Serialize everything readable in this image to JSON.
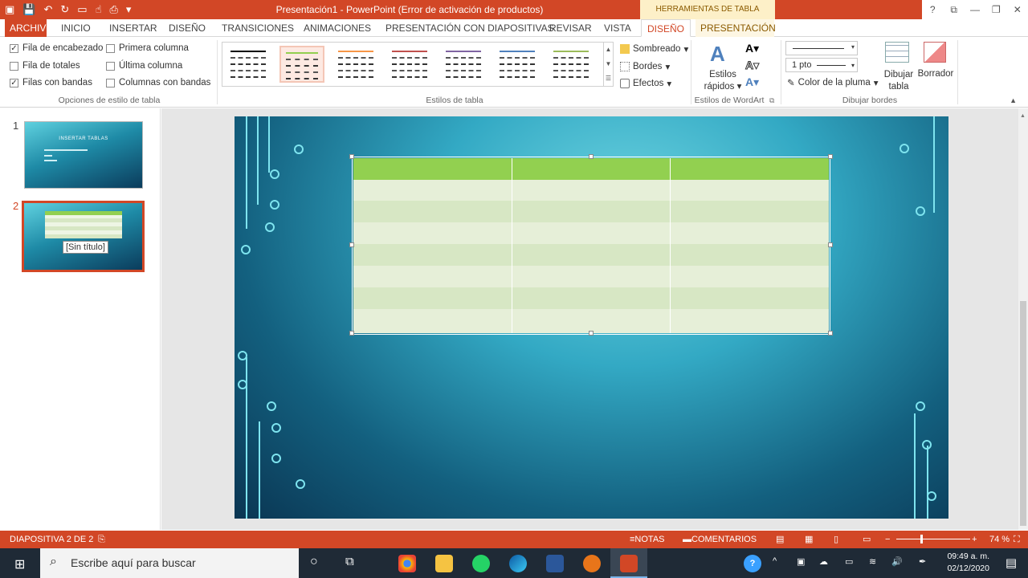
{
  "titlebar": {
    "app_title": "Presentación1 - PowerPoint (Error de activación de productos)",
    "contextual_header": "HERRAMIENTAS DE TABLA",
    "help": "?"
  },
  "tabs": {
    "file": "ARCHIVO",
    "inicio": "INICIO",
    "insertar": "INSERTAR",
    "diseno": "DISEÑO",
    "transiciones": "TRANSICIONES",
    "animaciones": "ANIMACIONES",
    "presentacion": "PRESENTACIÓN CON DIAPOSITIVAS",
    "revisar": "REVISAR",
    "vista": "VISTA",
    "diseno_tabla": "DISEÑO",
    "presentacion_tabla": "PRESENTACIÓN"
  },
  "ribbon": {
    "options": {
      "fila_encabezado": "Fila de encabezado",
      "fila_totales": "Fila de totales",
      "filas_bandas": "Filas con bandas",
      "primera_columna": "Primera columna",
      "ultima_columna": "Última columna",
      "columnas_bandas": "Columnas con bandas",
      "group_label": "Opciones de estilo de tabla"
    },
    "styles_group_label": "Estilos de tabla",
    "sombreado": "Sombreado",
    "bordes": "Bordes",
    "efectos": "Efectos",
    "wordart": {
      "estilos_rapidos_1": "Estilos",
      "estilos_rapidos_2": "rápidos",
      "group_label": "Estilos de WordArt"
    },
    "borders": {
      "pen_weight": "1 pto",
      "pen_color": "Color de la pluma",
      "dibujar_tabla_1": "Dibujar",
      "dibujar_tabla_2": "tabla",
      "borrador": "Borrador",
      "group_label": "Dibujar bordes"
    },
    "style_colors": [
      "#000000",
      "#92d050",
      "#f79646",
      "#c0504d",
      "#8064a2",
      "#4f81bd",
      "#9bbb59"
    ]
  },
  "thumbnails": {
    "slide1_number": "1",
    "slide1_title": "INSERTAR TABLAS",
    "slide2_number": "2",
    "slide2_tooltip": "[Sin título]"
  },
  "statusbar": {
    "slide_info": "DIAPOSITIVA 2 DE 2",
    "notas": "NOTAS",
    "comentarios": "COMENTARIOS",
    "zoom": "74 %"
  },
  "taskbar": {
    "search_placeholder": "Escribe aquí para buscar",
    "time": "09:49 a. m.",
    "date": "02/12/2020"
  },
  "colors": {
    "accent": "#d24726",
    "table_header": "#92d050",
    "table_band": "#d7e7c4",
    "table_light": "#e6efd8"
  }
}
